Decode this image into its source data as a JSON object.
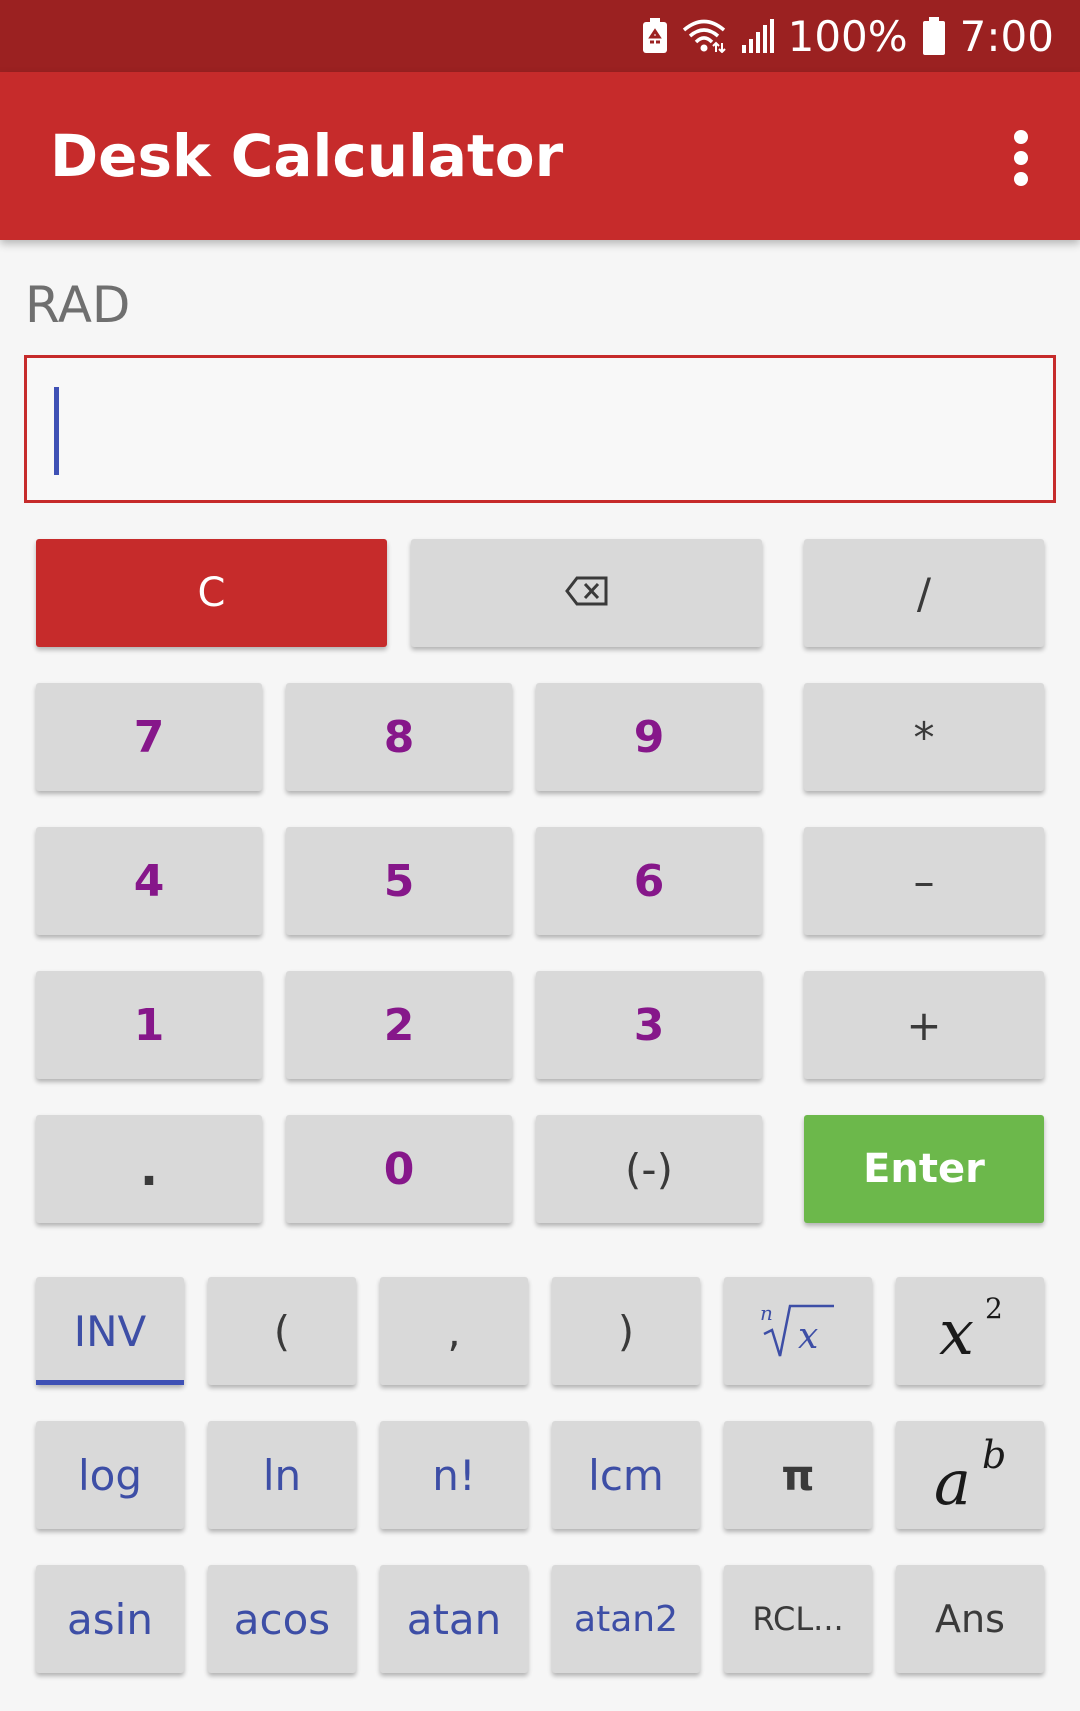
{
  "status_bar": {
    "battery_percent": "100%",
    "time": "7:00"
  },
  "app_bar": {
    "title": "Desk Calculator"
  },
  "display": {
    "angle_mode": "RAD",
    "expression": ""
  },
  "buttons": {
    "clear": "C",
    "divide": "/",
    "multiply": "*",
    "subtract": "–",
    "add": "+",
    "enter": "Enter",
    "digit_7": "7",
    "digit_8": "8",
    "digit_9": "9",
    "digit_4": "4",
    "digit_5": "5",
    "digit_6": "6",
    "digit_1": "1",
    "digit_2": "2",
    "digit_3": "3",
    "decimal": ".",
    "digit_0": "0",
    "negate": "(-)",
    "inv": "INV",
    "open_paren": "(",
    "comma": ",",
    "close_paren": ")",
    "log": "log",
    "ln": "ln",
    "factorial": "n!",
    "lcm": "lcm",
    "pi": "π",
    "asin": "asin",
    "acos": "acos",
    "atan": "atan",
    "atan2": "atan2",
    "recall": "RCL...",
    "ans": "Ans"
  },
  "icons": {
    "backspace": "backspace-icon",
    "nth_root": "nth-root-icon",
    "square": "x-squared-icon",
    "power": "a-to-the-b-icon",
    "overflow": "more-vert-icon"
  },
  "colors": {
    "status_bar": "#9b2121",
    "app_bar": "#c62b2b",
    "clear_key": "#c62b2b",
    "enter_key": "#6cb84b",
    "digit_text": "#86178a",
    "function_text": "#3d4ea6",
    "key_background": "#d9d9d9"
  }
}
